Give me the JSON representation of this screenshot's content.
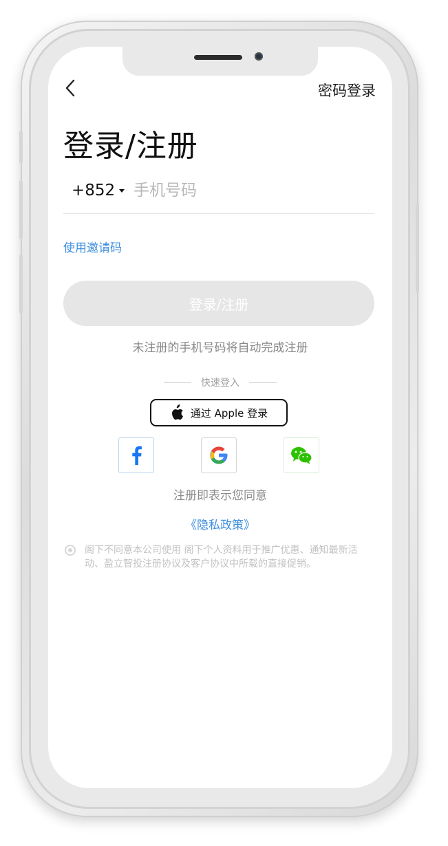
{
  "header": {
    "password_login_label": "密码登录",
    "back_icon": "chevron-left-icon"
  },
  "page": {
    "title": "登录/注册"
  },
  "phone": {
    "country_code": "+852",
    "placeholder": "手机号码"
  },
  "invite_link": "使用邀请码",
  "submit_button": "登录/注册",
  "auto_register_hint": "未注册的手机号码将自动完成注册",
  "quick_login": {
    "label": "快速登入",
    "apple_button": "通过 Apple 登录",
    "providers": [
      {
        "name": "facebook",
        "icon": "facebook-icon",
        "color": "#1877f2"
      },
      {
        "name": "google",
        "icon": "google-icon",
        "color": "#4285f4"
      },
      {
        "name": "wechat",
        "icon": "wechat-icon",
        "color": "#2dc100"
      }
    ]
  },
  "agreement": {
    "text": "注册即表示您同意",
    "privacy_link": "《隐私政策》",
    "consent_text": "阁下不同意本公司使用 阁下个人资料用于推广优惠、通知最新活动、盈立智投注册协议及客户协议中所载的直接促销。"
  },
  "colors": {
    "accent": "#3f8fe0",
    "disabled_button": "#e6e6e6"
  }
}
